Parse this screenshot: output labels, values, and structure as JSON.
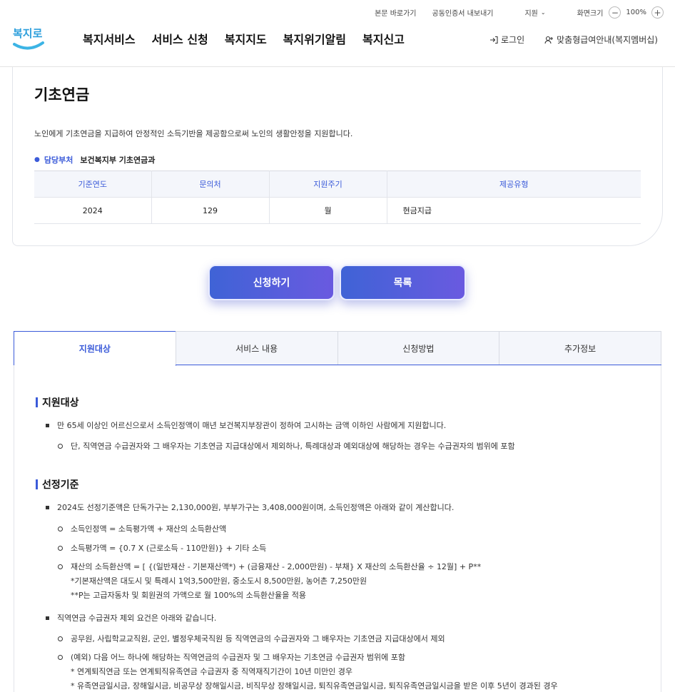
{
  "util": {
    "skip": "본문 바로가기",
    "cert": "공동인증서 내보내기",
    "support": "지원",
    "zoom_label": "화면크기",
    "zoom_value": "100%"
  },
  "logo_text": "복지로",
  "gnb": [
    "복지서비스",
    "서비스 신청",
    "복지지도",
    "복지위기알림",
    "복지신고"
  ],
  "member": {
    "login": "로그인",
    "guide": "맞춤형급여안내(복지멤버십)"
  },
  "page": {
    "title": "기초연금",
    "description": "노인에게 기초연금을 지급하여 안정적인 소득기반을 제공함으로써 노인의 생활안정을 지원합니다.",
    "dept_label": "담당부처",
    "dept_value": "보건복지부 기초연금과"
  },
  "info_table": {
    "headers": [
      "기준연도",
      "문의처",
      "지원주기",
      "제공유형"
    ],
    "row": [
      "2024",
      "129",
      "월",
      "현금지급"
    ]
  },
  "buttons": {
    "apply": "신청하기",
    "list": "목록"
  },
  "tabs": [
    "지원대상",
    "서비스 내용",
    "신청방법",
    "추가정보"
  ],
  "sections": {
    "target_title": "지원대상",
    "target_l1": "만 65세 이상인 어르신으로서 소득인정액이 매년 보건복지부장관이 정하여 고시하는 금액 이하인 사람에게 지원합니다.",
    "target_l2": "단, 직역연금 수급권자와 그 배우자는 기초연금 지급대상에서 제외하나, 특례대상과 예외대상에 해당하는 경우는 수급권자의 범위에 포함",
    "criteria_title": "선정기준",
    "criteria_l1": "2024도 선정기준액은 단독가구는 2,130,000원, 부부가구는 3,408,000원이며, 소득인정액은 아래와 같이 계산합니다.",
    "criteria_l2a": "소득인정액 = 소득평가액 + 재산의 소득환산액",
    "criteria_l2b": "소득평가액 = {0.7 X (근로소득 - 110만원)} + 기타 소득",
    "criteria_l2c_1": "재산의 소득환산액 = [ {(일반재산 - 기본재산액*) + (금융재산 - 2,000만원) - 부채} X 재산의 소득환산율 ÷ 12월] + P**",
    "criteria_l2c_2": "*기본재산액은 대도시 및 특례시 1억3,500만원, 중소도시 8,500만원, 농어촌 7,250만원",
    "criteria_l2c_3": "**P는 고급자동차 및 회원권의 가액으로 월 100%의 소득환산율을 적용",
    "excl_l1": "직역연금 수급권자 제외 요건은 아래와 같습니다.",
    "excl_l2a": "공무원, 사립학교교직원, 군인, 별정우체국직원 등 직역연금의 수급권자와 그 배우자는 기초연금 지급대상에서 제외",
    "excl_l2b_1": "(예외) 다음 어느 하나에 해당하는 직역연금의 수급권자 및 그 배우자는 기초연금 수급권자 범위에 포함",
    "excl_l2b_2": "* 연계퇴직연금 또는 연계퇴직유족연금 수급권자 중 직역재직기간이 10년 미만인 경우",
    "excl_l2b_3": "* 유족연금일시금, 장해일시금, 비공무상 장해일시금, 비직무상 장해일시금, 퇴직유족연금일시금, 퇴직유족연금일시금을 받은 이후 5년이 경과된 경우"
  }
}
